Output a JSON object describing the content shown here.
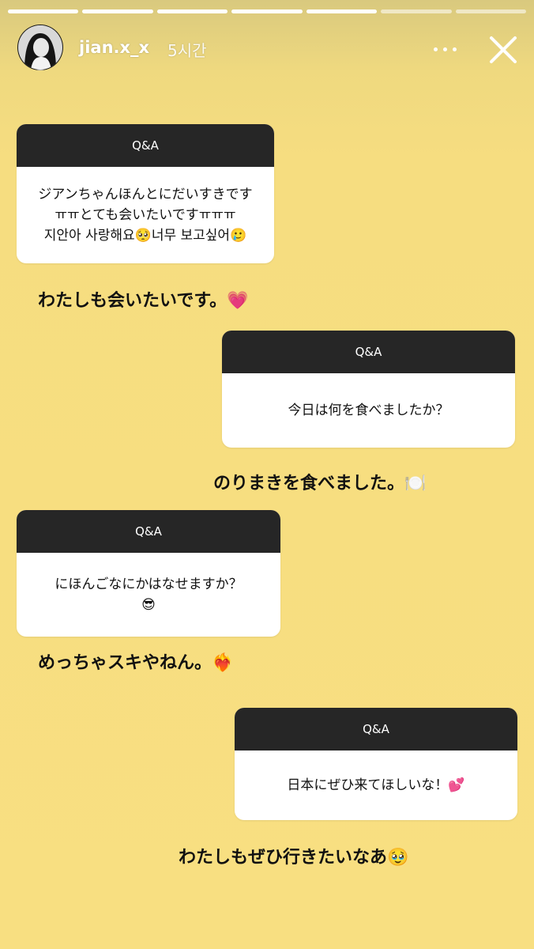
{
  "story": {
    "segments": 7,
    "segments_viewed": 5,
    "username": "jian.x_x",
    "time": "5시간"
  },
  "cards": [
    {
      "header": "Q&A",
      "lines": [
        "ジアンちゃんほんとにだいすきです",
        "ㅠㅠとても会いたいですㅠㅠㅠ",
        "지안아 사랑해요🥺너무 보고싶어🥲"
      ],
      "answer": "わたしも会いたいです。💗"
    },
    {
      "header": "Q&A",
      "lines": [
        "今日は何を食べましたか？"
      ],
      "answer": "のりまきを食べました。🍽️"
    },
    {
      "header": "Q&A",
      "lines": [
        "にほんごなにかはなせますか？",
        "😎"
      ],
      "answer": "めっちゃスキやねん。❤️‍🔥"
    },
    {
      "header": "Q&A",
      "lines": [
        "日本にぜひ来てほしいな！💕"
      ],
      "answer": "わたしもぜひ行きたいなあ🥹"
    }
  ]
}
